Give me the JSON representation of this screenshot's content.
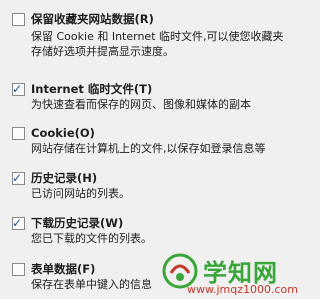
{
  "options": [
    {
      "checked": false,
      "title": "保留收藏夹网站数据(R)",
      "desc": [
        "保留 Cookie 和 Internet 临时文件,可以使您收藏夹",
        "存储好选项并提高显示速度。"
      ]
    },
    {
      "checked": true,
      "title": "Internet 临时文件(T)",
      "desc": [
        "为快速查看而保存的网页、图像和媒体的副本"
      ]
    },
    {
      "checked": false,
      "title": "Cookie(O)",
      "desc": [
        "网站存储在计算机上的文件,以保存如登录信息等"
      ]
    },
    {
      "checked": true,
      "title": "历史记录(H)",
      "desc": [
        "已访问网站的列表。"
      ]
    },
    {
      "checked": true,
      "title": "下载历史记录(W)",
      "desc": [
        "您已下载的文件的列表。"
      ]
    },
    {
      "checked": false,
      "title": "表单数据(F)",
      "desc": [
        "保存在表单中键入的信息"
      ]
    }
  ],
  "watermark": {
    "name": "学知网",
    "url": "www.jmqz1000.com"
  },
  "colors": {
    "background": "#f0f0f0",
    "check": "#2b4f8c",
    "watermark_green": "#3aa63a",
    "watermark_red": "#c0392b"
  }
}
